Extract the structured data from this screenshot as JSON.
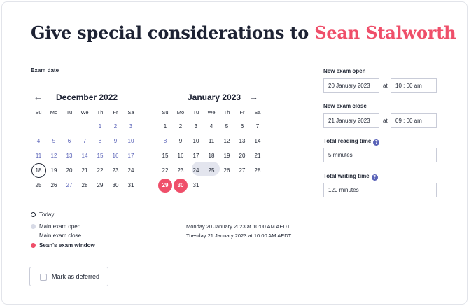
{
  "heading": {
    "prefix": "Give special considerations to ",
    "name": "Sean Stalworth"
  },
  "exam_date_label": "Exam date",
  "calendar": {
    "prev_icon": "←",
    "next_icon": "→",
    "weekdays": [
      "Su",
      "Mo",
      "Tu",
      "We",
      "Th",
      "Fr",
      "Sa"
    ],
    "months": [
      {
        "name": "December 2022",
        "lead_blanks": 4,
        "days": [
          {
            "d": "1",
            "blue": true
          },
          {
            "d": "2",
            "blue": true
          },
          {
            "d": "3",
            "blue": true
          },
          {
            "d": "4",
            "blue": true
          },
          {
            "d": "5",
            "blue": true
          },
          {
            "d": "6",
            "blue": true
          },
          {
            "d": "7",
            "blue": true
          },
          {
            "d": "8",
            "blue": true
          },
          {
            "d": "9",
            "blue": true
          },
          {
            "d": "10",
            "blue": true
          },
          {
            "d": "11",
            "blue": true
          },
          {
            "d": "12",
            "blue": true
          },
          {
            "d": "13",
            "blue": true
          },
          {
            "d": "14",
            "blue": true
          },
          {
            "d": "15",
            "blue": true
          },
          {
            "d": "16",
            "blue": true
          },
          {
            "d": "17",
            "blue": true
          },
          {
            "d": "18",
            "today": true
          },
          {
            "d": "19"
          },
          {
            "d": "20"
          },
          {
            "d": "21"
          },
          {
            "d": "22"
          },
          {
            "d": "23"
          },
          {
            "d": "24"
          },
          {
            "d": "25"
          },
          {
            "d": "26"
          },
          {
            "d": "27",
            "blue": true
          },
          {
            "d": "28"
          },
          {
            "d": "29"
          },
          {
            "d": "30"
          },
          {
            "d": "31"
          }
        ]
      },
      {
        "name": "January 2023",
        "lead_blanks": 0,
        "days": [
          {
            "d": "1"
          },
          {
            "d": "2"
          },
          {
            "d": "3"
          },
          {
            "d": "4"
          },
          {
            "d": "5"
          },
          {
            "d": "6"
          },
          {
            "d": "7"
          },
          {
            "d": "8",
            "blue": true
          },
          {
            "d": "9"
          },
          {
            "d": "10"
          },
          {
            "d": "11"
          },
          {
            "d": "12"
          },
          {
            "d": "13"
          },
          {
            "d": "14"
          },
          {
            "d": "15"
          },
          {
            "d": "16"
          },
          {
            "d": "17"
          },
          {
            "d": "18"
          },
          {
            "d": "19"
          },
          {
            "d": "20"
          },
          {
            "d": "21"
          },
          {
            "d": "22"
          },
          {
            "d": "23"
          },
          {
            "d": "24"
          },
          {
            "d": "25"
          },
          {
            "d": "26"
          },
          {
            "d": "27"
          },
          {
            "d": "28"
          },
          {
            "d": "29"
          },
          {
            "d": "30"
          },
          {
            "d": "31"
          }
        ]
      }
    ]
  },
  "legend": {
    "today": "Today",
    "main_open": "Main exam open",
    "main_close": "Main exam close",
    "window": "Sean's exam window",
    "open_date": "Monday 20 January 2023 at 10:00 AM AEDT",
    "close_date": "Tuesday 21 January 2023 at 10:00 AM AEDT"
  },
  "deferred_label": "Mark as deferred",
  "form": {
    "new_open_label": "New exam open",
    "new_open_date": "20 January 2023",
    "new_open_time": "10 : 00 am",
    "new_close_label": "New exam close",
    "new_close_date": "21 January 2023",
    "new_close_time": "09 : 00 am",
    "at": "at",
    "reading_label": "Total reading time",
    "reading_value": "5 minutes",
    "writing_label": "Total writing time",
    "writing_value": "120 minutes",
    "help_icon": "?"
  },
  "colors": {
    "accent": "#ef4f6a",
    "link": "#5a63b8",
    "highlight": "#e3e5ee",
    "text": "#1d2233"
  }
}
